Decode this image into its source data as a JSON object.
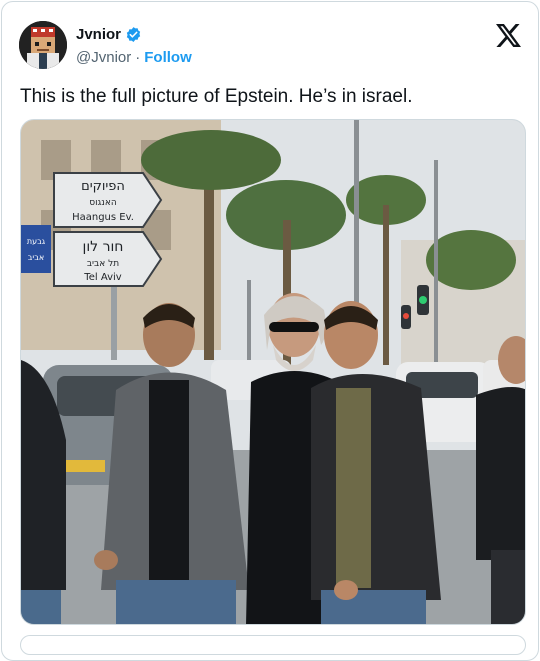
{
  "author": {
    "display_name": "Jvnior",
    "handle": "@Jvnior",
    "separator": "·",
    "follow_label": "Follow"
  },
  "tweet": {
    "text": "This is the full picture of Epstein. He’s in israel."
  },
  "photo": {
    "sign_top_line1": "הפיוקים",
    "sign_top_line2": "האנגוס",
    "sign_top_line3": "Haangus Ev.",
    "sign_bottom_line1": "חור לון",
    "sign_bottom_line2": "תל אביב",
    "sign_bottom_line3": "Tel Aviv",
    "sign_left_line1": "גבעת",
    "sign_left_line2": "אביב"
  },
  "colors": {
    "accent": "#1d9bf0",
    "text_primary": "#0f1419",
    "text_secondary": "#536471",
    "border": "#cfd9de"
  },
  "icons": {
    "verified": "verified-badge-icon",
    "platform": "x-logo-icon"
  }
}
